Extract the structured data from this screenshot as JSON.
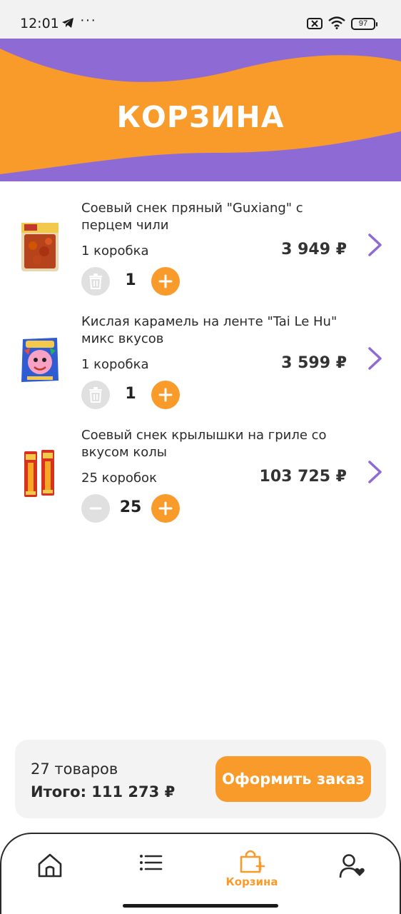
{
  "status_bar": {
    "time": "12:01",
    "dots": "···",
    "battery": "97"
  },
  "header": {
    "title": "КОРЗИНА",
    "colors": {
      "purple": "#8e6ad4",
      "orange": "#f89b2b"
    }
  },
  "cart": {
    "items": [
      {
        "name": "Соевый снек пряный \"Guxiang\" с перцем чили",
        "quantity_label": "1 коробка",
        "price": "3 949 ₽",
        "count": "1",
        "decrement_icon": "trash-icon"
      },
      {
        "name": "Кислая карамель на ленте \"Tai Le Hu\" микс вкусов",
        "quantity_label": "1 коробка",
        "price": "3 599 ₽",
        "count": "1",
        "decrement_icon": "trash-icon"
      },
      {
        "name": "Соевый снек крылышки на гриле со вкусом колы",
        "quantity_label": "25 коробок",
        "price": "103 725 ₽",
        "count": "25",
        "decrement_icon": "minus-icon"
      }
    ]
  },
  "summary": {
    "items_count": "27 товаров",
    "total": "Итого: 111 273 ₽",
    "checkout_label": "Оформить заказ"
  },
  "nav": {
    "items": [
      {
        "icon": "home-icon",
        "label": ""
      },
      {
        "icon": "catalog-list-icon",
        "label": ""
      },
      {
        "icon": "cart-icon",
        "label": "Корзина",
        "active": true
      },
      {
        "icon": "profile-icon",
        "label": ""
      }
    ]
  }
}
